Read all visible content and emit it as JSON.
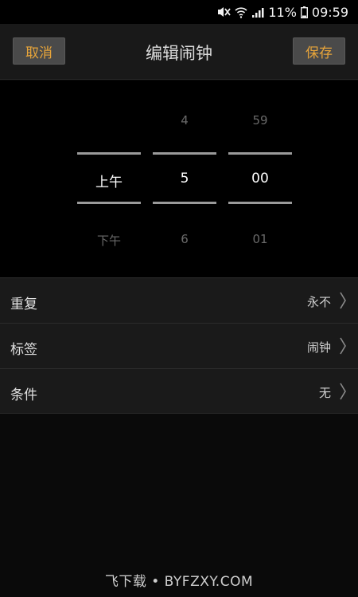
{
  "status_bar": {
    "battery": "11%",
    "time": "09:59",
    "icons": [
      "mute-icon",
      "wifi-icon",
      "signal-icon",
      "battery-icon"
    ]
  },
  "header": {
    "cancel_label": "取消",
    "title": "编辑闹钟",
    "save_label": "保存"
  },
  "time_picker": {
    "ampm": {
      "prev": "",
      "current": "上午",
      "next": "下午"
    },
    "hour": {
      "prev": "4",
      "current": "5",
      "next": "6"
    },
    "minute": {
      "prev": "59",
      "current": "00",
      "next": "01"
    }
  },
  "settings": [
    {
      "label": "重复",
      "value": "永不"
    },
    {
      "label": "标签",
      "value": "闹钟"
    },
    {
      "label": "条件",
      "value": "无"
    }
  ],
  "watermark": "飞下载 • BYFZXY.COM",
  "colors": {
    "accent": "#e8a53a",
    "background": "#000000",
    "row_background": "#1a1a1a",
    "header_background": "#191919"
  }
}
